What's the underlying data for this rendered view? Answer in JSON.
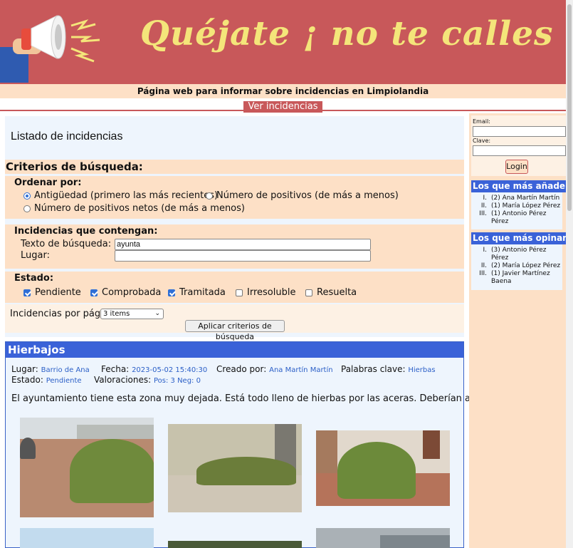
{
  "header": {
    "title": "Quéjate ¡ no te calles !",
    "tagline": "Página web para informar sobre incidencias en Limpiolandia",
    "nav_link": "Ver incidencias"
  },
  "main": {
    "heading": "Listado de incidencias",
    "criteria_title": "Criterios de búsqueda:",
    "order": {
      "label": "Ordenar por:",
      "options": [
        {
          "label": "Antigüedad (primero las más recientes)",
          "selected": true
        },
        {
          "label": "Número de positivos (de más a menos)",
          "selected": false
        },
        {
          "label": "Número de positivos netos (de más a menos)",
          "selected": false
        }
      ]
    },
    "text_filter": {
      "label": "Incidencias que contengan:",
      "text_label": "Texto de búsqueda:",
      "text_value": "ayunta",
      "place_label": "Lugar:",
      "place_value": ""
    },
    "state": {
      "label": "Estado:",
      "options": [
        {
          "label": "Pendiente",
          "checked": true
        },
        {
          "label": "Comprobada",
          "checked": true
        },
        {
          "label": "Tramitada",
          "checked": true
        },
        {
          "label": "Irresoluble",
          "checked": false
        },
        {
          "label": "Resuelta",
          "checked": false
        }
      ]
    },
    "per_page": {
      "label": "Incidencias por página",
      "value": "3 items"
    },
    "apply_label": "Aplicar criterios de búsqueda"
  },
  "incident": {
    "title": "Hierbajos",
    "place_label": "Lugar:",
    "place_value": "Barrio de Ana",
    "date_label": "Fecha:",
    "date_value": "2023-05-02 15:40:30",
    "author_label": "Creado por:",
    "author_value": "Ana Martín Martín",
    "keywords_label": "Palabras clave:",
    "keywords_value": "Hierbas",
    "state_label": "Estado:",
    "state_value": "Pendiente",
    "ratings_label": "Valoraciones:",
    "ratings_value": "Pos: 3 Neg: 0",
    "description": "El ayuntamiento tiene esta zona muy dejada. Está todo lleno de hierbas por las aceras. Deberían actuar ya"
  },
  "sidebar": {
    "email_label": "Email:",
    "password_label": "Clave:",
    "login_label": "Login",
    "top_adders": {
      "title": "Los que más añaden",
      "items": [
        {
          "rank": "I.",
          "count": "(2)",
          "name": "Ana Martín Martín"
        },
        {
          "rank": "II.",
          "count": "(1)",
          "name": "María López Pérez"
        },
        {
          "rank": "III.",
          "count": "(1)",
          "name": "Antonio Pérez Pérez"
        }
      ]
    },
    "top_commenters": {
      "title": "Los que más opinan",
      "items": [
        {
          "rank": "I.",
          "count": "(3)",
          "name": "Antonio Pérez Pérez"
        },
        {
          "rank": "II.",
          "count": "(2)",
          "name": "María López Pérez"
        },
        {
          "rank": "III.",
          "count": "(1)",
          "name": "Javier Martínez Baena"
        }
      ]
    }
  },
  "colors": {
    "brand": "#c8585a",
    "title_yellow": "#f4e57a",
    "panel": "#fde0c6",
    "accent_blue": "#3a62d8"
  }
}
